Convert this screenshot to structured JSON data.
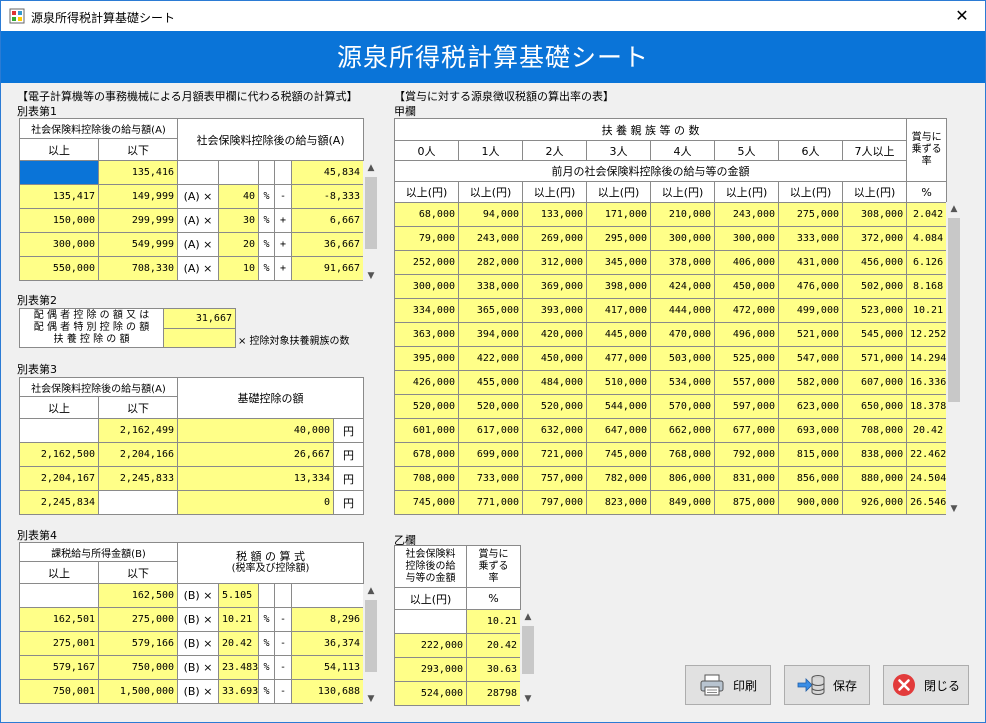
{
  "window": {
    "title": "源泉所得税計算基礎シート",
    "close_glyph": "✕"
  },
  "banner": {
    "title": "源泉所得税計算基礎シート"
  },
  "left_heading": "【電子計算機等の事務機械による月額表甲欄に代わる税額の計算式】",
  "t1": {
    "label": "別表第1",
    "hdr_range": "社会保険料控除後の給与額(A)",
    "hdr_ijo": "以上",
    "hdr_ika": "以下",
    "hdr_formula": "社会保険料控除後の給与額(A)",
    "rows": [
      {
        "from": "",
        "to": "135,416",
        "a": "",
        "pct": "",
        "p": "",
        "op": "",
        "amt": "45,834"
      },
      {
        "from": "135,417",
        "to": "149,999",
        "a": "(A) ×",
        "pct": "40",
        "p": "%",
        "op": "-",
        "amt": "-8,333"
      },
      {
        "from": "150,000",
        "to": "299,999",
        "a": "(A) ×",
        "pct": "30",
        "p": "%",
        "op": "+",
        "amt": "6,667"
      },
      {
        "from": "300,000",
        "to": "549,999",
        "a": "(A) ×",
        "pct": "20",
        "p": "%",
        "op": "+",
        "amt": "36,667"
      },
      {
        "from": "550,000",
        "to": "708,330",
        "a": "(A) ×",
        "pct": "10",
        "p": "%",
        "op": "+",
        "amt": "91,667"
      }
    ]
  },
  "t2": {
    "label": "別表第2",
    "desc_1": "配 偶 者 控 除 の 額 又 は",
    "desc_2": "配 偶 者 特 別 控 除 の 額",
    "desc_3": "扶 養 控 除 の 額",
    "value": "31,667",
    "note": "× 控除対象扶養親族の数"
  },
  "t3": {
    "label": "別表第3",
    "hdr_range": "社会保険料控除後の給与額(A)",
    "hdr_ijo": "以上",
    "hdr_ika": "以下",
    "hdr_basic": "基礎控除の額",
    "unit": "円",
    "rows": [
      {
        "from": "",
        "to": "2,162,499",
        "amt": "40,000"
      },
      {
        "from": "2,162,500",
        "to": "2,204,166",
        "amt": "26,667"
      },
      {
        "from": "2,204,167",
        "to": "2,245,833",
        "amt": "13,334"
      },
      {
        "from": "2,245,834",
        "to": "",
        "amt": "0"
      }
    ]
  },
  "t4": {
    "label": "別表第4",
    "hdr_range": "課税給与所得金額(B)",
    "hdr_ijo": "以上",
    "hdr_ika": "以下",
    "hdr_formula_1": "税 額 の 算 式",
    "hdr_formula_2": "(税率及び控除額)",
    "rows": [
      {
        "from": "",
        "to": "162,500",
        "b": "(B) ×",
        "rate": "5.105",
        "p": "",
        "op": "",
        "amt": ""
      },
      {
        "from": "162,501",
        "to": "275,000",
        "b": "(B) ×",
        "rate": "10.21",
        "p": "%",
        "op": "-",
        "amt": "8,296"
      },
      {
        "from": "275,001",
        "to": "579,166",
        "b": "(B) ×",
        "rate": "20.42",
        "p": "%",
        "op": "-",
        "amt": "36,374"
      },
      {
        "from": "579,167",
        "to": "750,000",
        "b": "(B) ×",
        "rate": "23.483",
        "p": "%",
        "op": "-",
        "amt": "54,113"
      },
      {
        "from": "750,001",
        "to": "1,500,000",
        "b": "(B) ×",
        "rate": "33.693",
        "p": "%",
        "op": "-",
        "amt": "130,688"
      }
    ]
  },
  "right_heading": "【賞与に対する源泉徴収税額の算出率の表】",
  "kou": {
    "label": "甲欄",
    "hdr_fuyou": "扶 養 親 族 等 の 数",
    "hdr_rate_1": "賞与に",
    "hdr_rate_2": "乗ずる",
    "hdr_rate_3": "率",
    "dependents": [
      "0人",
      "1人",
      "2人",
      "3人",
      "4人",
      "5人",
      "6人",
      "7人以上"
    ],
    "hdr_prev": "前月の社会保険料控除後の給与等の金額",
    "col_ijo": "以上(円)",
    "col_pct": "%",
    "rows": [
      [
        "68,000",
        "94,000",
        "133,000",
        "171,000",
        "210,000",
        "243,000",
        "275,000",
        "308,000",
        "2.042"
      ],
      [
        "79,000",
        "243,000",
        "269,000",
        "295,000",
        "300,000",
        "300,000",
        "333,000",
        "372,000",
        "4.084"
      ],
      [
        "252,000",
        "282,000",
        "312,000",
        "345,000",
        "378,000",
        "406,000",
        "431,000",
        "456,000",
        "6.126"
      ],
      [
        "300,000",
        "338,000",
        "369,000",
        "398,000",
        "424,000",
        "450,000",
        "476,000",
        "502,000",
        "8.168"
      ],
      [
        "334,000",
        "365,000",
        "393,000",
        "417,000",
        "444,000",
        "472,000",
        "499,000",
        "523,000",
        "10.21"
      ],
      [
        "363,000",
        "394,000",
        "420,000",
        "445,000",
        "470,000",
        "496,000",
        "521,000",
        "545,000",
        "12.252"
      ],
      [
        "395,000",
        "422,000",
        "450,000",
        "477,000",
        "503,000",
        "525,000",
        "547,000",
        "571,000",
        "14.294"
      ],
      [
        "426,000",
        "455,000",
        "484,000",
        "510,000",
        "534,000",
        "557,000",
        "582,000",
        "607,000",
        "16.336"
      ],
      [
        "520,000",
        "520,000",
        "520,000",
        "544,000",
        "570,000",
        "597,000",
        "623,000",
        "650,000",
        "18.378"
      ],
      [
        "601,000",
        "617,000",
        "632,000",
        "647,000",
        "662,000",
        "677,000",
        "693,000",
        "708,000",
        "20.42"
      ],
      [
        "678,000",
        "699,000",
        "721,000",
        "745,000",
        "768,000",
        "792,000",
        "815,000",
        "838,000",
        "22.462"
      ],
      [
        "708,000",
        "733,000",
        "757,000",
        "782,000",
        "806,000",
        "831,000",
        "856,000",
        "880,000",
        "24.504"
      ],
      [
        "745,000",
        "771,000",
        "797,000",
        "823,000",
        "849,000",
        "875,000",
        "900,000",
        "926,000",
        "26.546"
      ]
    ]
  },
  "otsu": {
    "label": "乙欄",
    "hdr_a_1": "社会保険料",
    "hdr_a_2": "控除後の給",
    "hdr_a_3": "与等の金額",
    "hdr_b_1": "賞与に",
    "hdr_b_2": "乗ずる",
    "hdr_b_3": "率",
    "col_ijo": "以上(円)",
    "col_pct": "%",
    "rows": [
      [
        "",
        "10.21"
      ],
      [
        "222,000",
        "20.42"
      ],
      [
        "293,000",
        "30.63"
      ],
      [
        "524,000",
        "28798"
      ]
    ]
  },
  "buttons": {
    "print": "印刷",
    "save": "保存",
    "close": "閉じる"
  },
  "colors": {
    "banner": "#0a74d8",
    "cell_yellow": "#ffff88",
    "selected": "#0a74d8",
    "close_red": "#e23b3b"
  }
}
